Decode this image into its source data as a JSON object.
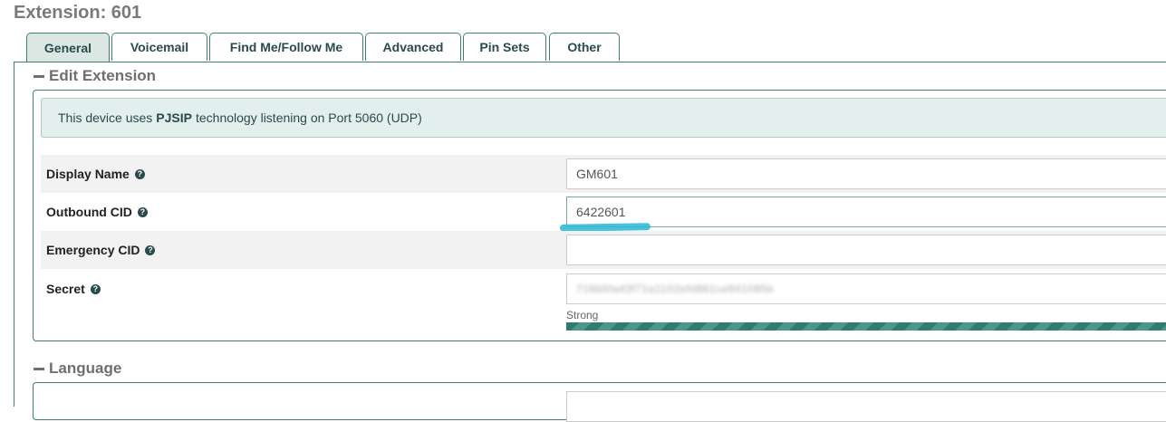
{
  "page": {
    "title": "Extension: 601"
  },
  "tabs": [
    {
      "label": "General",
      "active": true
    },
    {
      "label": "Voicemail"
    },
    {
      "label": "Find Me/Follow Me"
    },
    {
      "label": "Advanced"
    },
    {
      "label": "Pin Sets"
    },
    {
      "label": "Other"
    }
  ],
  "edit_extension": {
    "header": "Edit Extension",
    "alert": {
      "prefix": "This device uses",
      "tech": "PJSIP",
      "suffix": "technology listening on Port 5060 (UDP)"
    },
    "fields": [
      {
        "label": "Display Name",
        "value": "GM601"
      },
      {
        "label": "Outbound CID",
        "value": "6422601"
      },
      {
        "label": "Emergency CID",
        "value": ""
      },
      {
        "label": "Secret",
        "value": "716b5fa43f71a1102efd861ce841085b",
        "strength": "Strong",
        "strength_fraction": 1.0
      }
    ],
    "help_glyph": "?"
  },
  "language": {
    "header": "Language"
  },
  "colors": {
    "accent": "#3f7f70",
    "tab_active_bg": "#dbe7e3",
    "alert_bg": "#e3efed",
    "highlight": "#29b6d6"
  }
}
